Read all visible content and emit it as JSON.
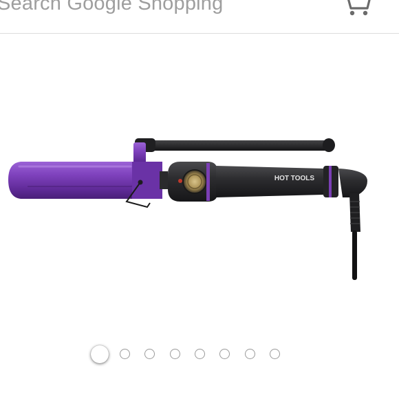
{
  "search": {
    "placeholder": "Search Google Shopping"
  },
  "header": {
    "cart_icon": "shopping-cart-icon"
  },
  "product": {
    "brand_label": "HOT TOOLS",
    "image_icon": "curling-iron-product-image"
  },
  "carousel": {
    "total_dots": 8,
    "active_index": 0
  },
  "colors": {
    "accent_purple": "#7b3fb5",
    "barrel_black": "#2a2a2c",
    "divider": "#dcdcdc",
    "placeholder_text": "#9e9e9e"
  }
}
